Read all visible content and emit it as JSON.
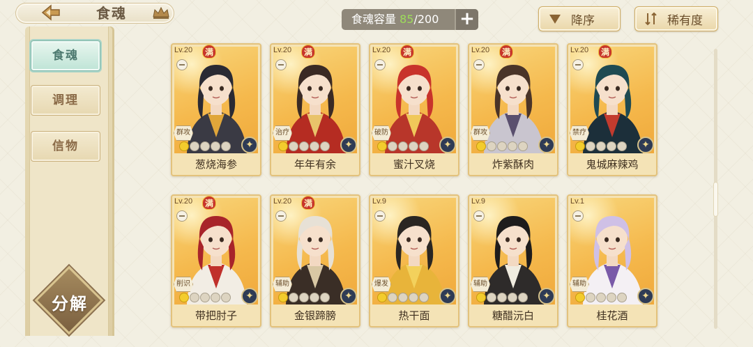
{
  "header": {
    "title": "食魂",
    "capacity_label": "食魂容量",
    "capacity_current": "85",
    "capacity_total": "/200",
    "capacity_add": "+",
    "sort_order": "降序",
    "sort_key": "稀有度"
  },
  "sidebar": {
    "tabs": [
      {
        "label": "食魂",
        "active": true
      },
      {
        "label": "调理",
        "active": false
      },
      {
        "label": "信物",
        "active": false
      }
    ],
    "decompose_label": "分解"
  },
  "cards": [
    {
      "level": "Lv.20",
      "max": "满",
      "role": "群攻",
      "stars": 1,
      "name": "葱烧海参",
      "hair": "#2a2a33",
      "outfit": "#3a3a44",
      "accent": "#e0a63a"
    },
    {
      "level": "Lv.20",
      "max": "满",
      "role": "治疗",
      "stars": 1,
      "name": "年年有余",
      "hair": "#3a2a24",
      "outfit": "#b52c22",
      "accent": "#e9c36a"
    },
    {
      "level": "Lv.20",
      "max": "满",
      "role": "破防",
      "stars": 1,
      "name": "蜜汁叉烧",
      "hair": "#c8332b",
      "outfit": "#b8362a",
      "accent": "#f0c85a"
    },
    {
      "level": "Lv.20",
      "max": "满",
      "role": "群攻",
      "stars": 1,
      "name": "炸紫酥肉",
      "hair": "#4a3428",
      "outfit": "#c9c5cf",
      "accent": "#5a4f6e"
    },
    {
      "level": "Lv.20",
      "max": "满",
      "role": "禁疗",
      "stars": 1,
      "name": "鬼城麻辣鸡",
      "hair": "#1f4a52",
      "outfit": "#1c2f3a",
      "accent": "#c23b2e"
    },
    {
      "level": "Lv.20",
      "max": "满",
      "role": "削识",
      "stars": 1,
      "name": "带把肘子",
      "hair": "#a8242a",
      "outfit": "#f2ede4",
      "accent": "#c0302b"
    },
    {
      "level": "Lv.20",
      "max": "满",
      "role": "辅助",
      "stars": 1,
      "name": "金银蹄膀",
      "hair": "#e7e1d6",
      "outfit": "#3a2e26",
      "accent": "#d9c8a4"
    },
    {
      "level": "Lv.9",
      "max": "",
      "role": "爆发",
      "stars": 1,
      "name": "热干面",
      "hair": "#2a2622",
      "outfit": "#e8b43a",
      "accent": "#f3d15c"
    },
    {
      "level": "Lv.9",
      "max": "",
      "role": "辅助",
      "stars": 1,
      "name": "糖醋沅白",
      "hair": "#1e1c1c",
      "outfit": "#2e2b2a",
      "accent": "#f0ece0"
    },
    {
      "level": "Lv.1",
      "max": "",
      "role": "辅助",
      "stars": 1,
      "name": "桂花酒",
      "hair": "#cfc0e6",
      "outfit": "#f4f0f4",
      "accent": "#7a5aa8"
    }
  ],
  "star_total": 5,
  "icons": {
    "back": "back-arrow-icon",
    "crown": "crown-icon",
    "sort_desc": "triangle-down-icon",
    "sort_rarity": "sort-arrows-icon",
    "element": "element-badge-icon"
  }
}
